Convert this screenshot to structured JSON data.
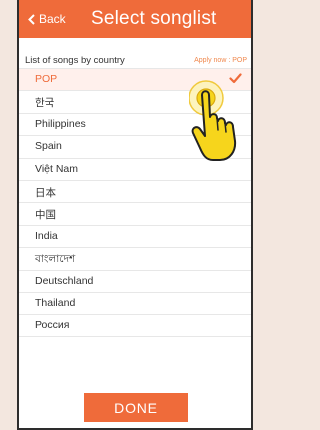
{
  "header": {
    "back_label": "Back",
    "title": "Select songlist"
  },
  "section": {
    "title": "List of songs by country",
    "apply_now": "Apply now : POP"
  },
  "countries": [
    "POP",
    "한국",
    "Philippines",
    "Spain",
    "Việt Nam",
    "日本",
    "中国",
    "India",
    "বাংলাদেশ",
    "Deutschland",
    "Thailand",
    "Россия"
  ],
  "selected_index": 0,
  "done_label": "DONE",
  "icons": {
    "back": "chevron-left-icon",
    "selected": "check-icon",
    "gesture": "tap-hand-icon"
  },
  "colors": {
    "accent": "#ef6b3a",
    "selected_row": "#fff0ec",
    "hand": "#f6d51c",
    "background": "#f3e7df"
  }
}
